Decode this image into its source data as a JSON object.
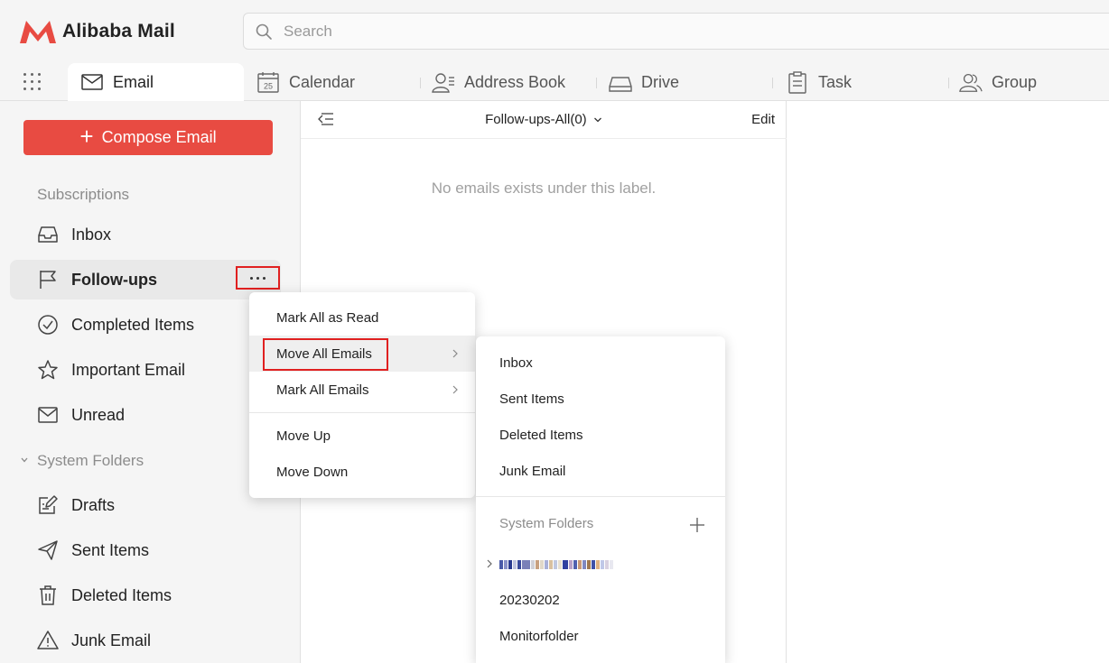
{
  "app": {
    "name": "Alibaba Mail",
    "brand_color": "#e84b42"
  },
  "search": {
    "placeholder": "Search"
  },
  "nav_tabs": [
    {
      "label": "Email",
      "icon": "mail-icon",
      "active": true
    },
    {
      "label": "Calendar",
      "icon": "calendar-icon",
      "active": false,
      "icon_text": "25"
    },
    {
      "label": "Address Book",
      "icon": "contacts-icon",
      "active": false
    },
    {
      "label": "Drive",
      "icon": "drive-icon",
      "active": false
    },
    {
      "label": "Task",
      "icon": "clipboard-icon",
      "active": false
    },
    {
      "label": "Group",
      "icon": "group-icon",
      "active": false
    }
  ],
  "sidebar": {
    "compose_label": "Compose Email",
    "subscriptions_title": "Subscriptions",
    "subscriptions": [
      {
        "label": "Inbox",
        "icon": "inbox-icon"
      },
      {
        "label": "Follow-ups",
        "icon": "flag-icon",
        "active": true
      },
      {
        "label": "Completed Items",
        "icon": "check-circle-icon"
      },
      {
        "label": "Important Email",
        "icon": "star-icon"
      },
      {
        "label": "Unread",
        "icon": "envelope-icon"
      }
    ],
    "system_folders_title": "System Folders",
    "system_folders": [
      {
        "label": "Drafts",
        "icon": "edit-icon"
      },
      {
        "label": "Sent Items",
        "icon": "send-icon"
      },
      {
        "label": "Deleted Items",
        "icon": "trash-icon"
      },
      {
        "label": "Junk Email",
        "icon": "warning-icon"
      }
    ]
  },
  "list": {
    "title": "Follow-ups-All",
    "count": "(0)",
    "edit_label": "Edit",
    "empty_text": "No emails exists under this label."
  },
  "context_menu": {
    "items": [
      {
        "label": "Mark All as Read"
      },
      {
        "label": "Move All Emails",
        "submenu": true,
        "highlighted": true
      },
      {
        "label": "Mark All Emails",
        "submenu": true
      },
      {
        "label": "Move Up"
      },
      {
        "label": "Move Down"
      }
    ]
  },
  "move_submenu": {
    "items": [
      {
        "label": "Inbox"
      },
      {
        "label": "Sent Items"
      },
      {
        "label": "Deleted Items"
      },
      {
        "label": "Junk Email"
      }
    ],
    "section_title": "System Folders",
    "folders": [
      {
        "label": "20230202"
      },
      {
        "label": "Monitorfolder"
      }
    ]
  },
  "colors": {
    "highlight_border": "#e02020",
    "accent_red": "#e84b42"
  }
}
